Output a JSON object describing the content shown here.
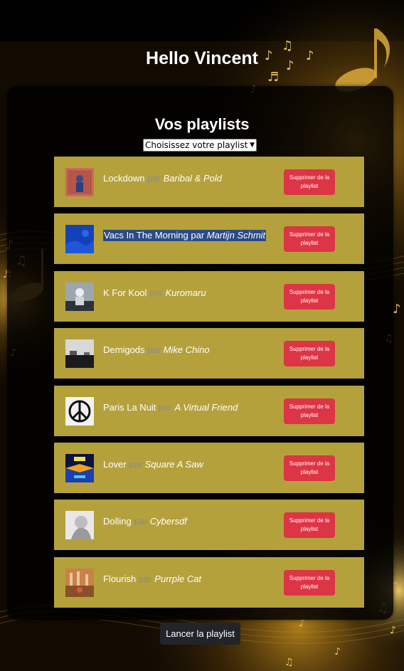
{
  "greeting": "Hello Vincent",
  "panel": {
    "title": "Vos playlists",
    "select": {
      "selected": "Choisissez votre playlist"
    }
  },
  "tracks": [
    {
      "title": "Lockdown",
      "par": "par",
      "artist": "Baribal & Pold",
      "delete_label": "Supprimer de la playlist",
      "cover": "cover-figure-red",
      "selected": false
    },
    {
      "title": "Vacs In The Morning",
      "par": "par",
      "artist": "Martijn Schmit",
      "delete_label": "Supprimer de la playlist",
      "cover": "cover-blue",
      "selected": true
    },
    {
      "title": "K For Kool",
      "par": "par",
      "artist": "Kuromaru",
      "delete_label": "Supprimer de la playlist",
      "cover": "cover-grey-figure",
      "selected": false
    },
    {
      "title": "Demigods",
      "par": "par",
      "artist": "Mike Chino",
      "delete_label": "Supprimer de la playlist",
      "cover": "cover-landscape",
      "selected": false
    },
    {
      "title": "Paris La Nuit",
      "par": "par",
      "artist": "A Virtual Friend",
      "delete_label": "Supprimer de la playlist",
      "cover": "cover-peace",
      "selected": false
    },
    {
      "title": "Lover",
      "par": "par",
      "artist": "Square A Saw",
      "delete_label": "Supprimer de la playlist",
      "cover": "cover-lover",
      "selected": false
    },
    {
      "title": "Dolling",
      "par": "par",
      "artist": "Cybersdf",
      "delete_label": "Supprimer de la playlist",
      "cover": "cover-white-figure",
      "selected": false
    },
    {
      "title": "Flourish",
      "par": "par",
      "artist": "Purrple Cat",
      "delete_label": "Supprimer de la playlist",
      "cover": "cover-room",
      "selected": false
    }
  ],
  "launch_label": "Lancer la playlist",
  "colors": {
    "track_bg": "#b4a13c",
    "delete_button": "#dc3545",
    "launch_button": "#212529",
    "selection": "#2b4b86"
  }
}
